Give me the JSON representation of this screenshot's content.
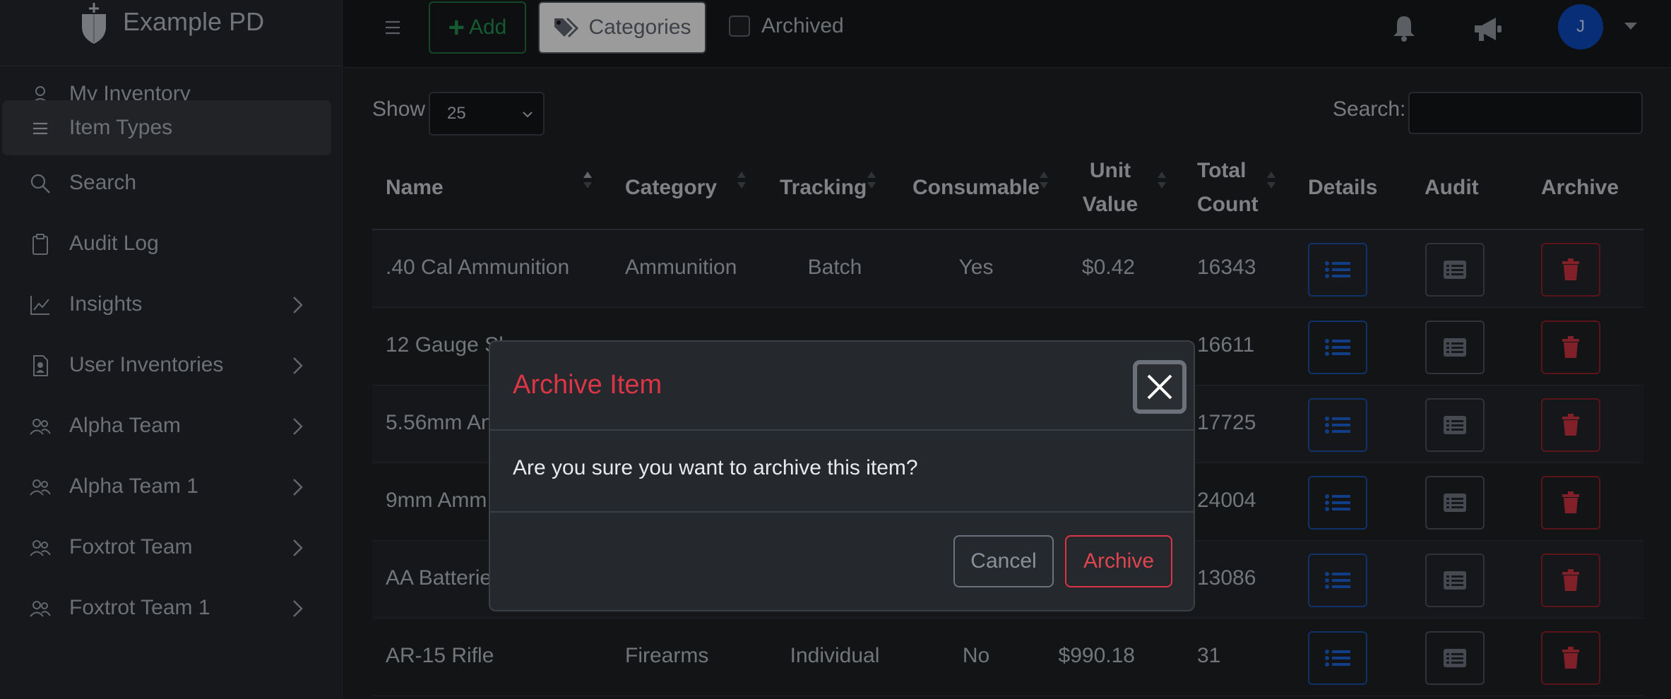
{
  "brand": {
    "name": "Example PD"
  },
  "sidebar": {
    "items": [
      {
        "label": "My Inventory",
        "icon": "user-icon",
        "expandable": false,
        "active": false
      },
      {
        "label": "Item Types",
        "icon": "list-icon",
        "expandable": false,
        "active": true
      },
      {
        "label": "Search",
        "icon": "search-icon",
        "expandable": false,
        "active": false
      },
      {
        "label": "Audit Log",
        "icon": "clipboard-icon",
        "expandable": false,
        "active": false
      },
      {
        "label": "Insights",
        "icon": "chart-icon",
        "expandable": true,
        "active": false
      },
      {
        "label": "User Inventories",
        "icon": "badge-icon",
        "expandable": true,
        "active": false
      },
      {
        "label": "Alpha Team",
        "icon": "team-icon",
        "expandable": true,
        "active": false
      },
      {
        "label": "Alpha Team 1",
        "icon": "team-icon",
        "expandable": true,
        "active": false
      },
      {
        "label": "Foxtrot Team",
        "icon": "team-icon",
        "expandable": true,
        "active": false
      },
      {
        "label": "Foxtrot Team 1",
        "icon": "team-icon",
        "expandable": true,
        "active": false
      }
    ]
  },
  "toolbar": {
    "add_label": "Add",
    "categories_label": "Categories",
    "archived_label": "Archived",
    "avatar_initial": "J"
  },
  "table_controls": {
    "show_label": "Show",
    "page_length": "25",
    "search_label": "Search:",
    "search_value": ""
  },
  "table": {
    "headers": {
      "name": "Name",
      "category": "Category",
      "tracking": "Tracking",
      "consumable": "Consumable",
      "unit_value_1": "Unit",
      "unit_value_2": "Value",
      "total_count_1": "Total",
      "total_count_2": "Count",
      "details": "Details",
      "audit": "Audit",
      "archive": "Archive"
    },
    "rows": [
      {
        "name": ".40 Cal Ammunition",
        "category": "Ammunition",
        "tracking": "Batch",
        "consumable": "Yes",
        "unit_value": "$0.42",
        "total_count": "16343"
      },
      {
        "name": "12 Gauge Sh",
        "category": "",
        "tracking": "",
        "consumable": "",
        "unit_value": "",
        "total_count": "16611"
      },
      {
        "name": "5.56mm An",
        "category": "",
        "tracking": "",
        "consumable": "",
        "unit_value": "",
        "total_count": "17725"
      },
      {
        "name": "9mm Amm",
        "category": "",
        "tracking": "",
        "consumable": "",
        "unit_value": "",
        "total_count": "24004"
      },
      {
        "name": "AA Batterie",
        "category": "",
        "tracking": "",
        "consumable": "",
        "unit_value": "",
        "total_count": "13086"
      },
      {
        "name": "AR-15 Rifle",
        "category": "Firearms",
        "tracking": "Individual",
        "consumable": "No",
        "unit_value": "$990.18",
        "total_count": "31"
      }
    ]
  },
  "modal": {
    "title": "Archive Item",
    "message": "Are you sure you want to archive this item?",
    "cancel_label": "Cancel",
    "confirm_label": "Archive"
  },
  "colors": {
    "accent_blue": "#1a4ea0",
    "danger_red": "#dc3545",
    "success_green": "#1f8a4d"
  }
}
